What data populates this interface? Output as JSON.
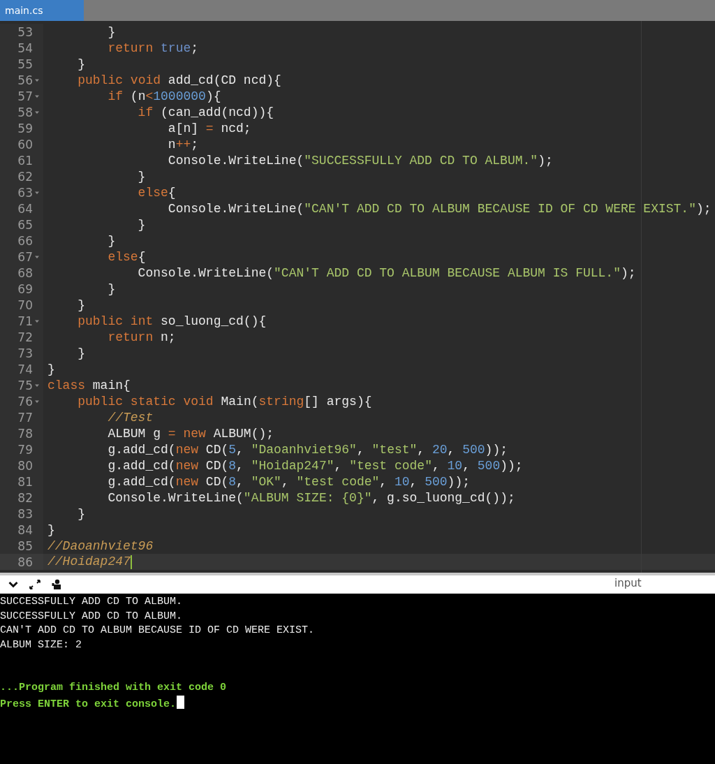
{
  "tabs": [
    {
      "label": "main.cs",
      "selected": true
    }
  ],
  "editor": {
    "lines": [
      {
        "number": "53",
        "foldable": false,
        "current": false,
        "tokens": [
          {
            "kind": "plain",
            "text": "        }"
          }
        ]
      },
      {
        "number": "54",
        "foldable": false,
        "current": false,
        "tokens": [
          {
            "kind": "keyword",
            "text": "        return"
          },
          {
            "kind": "literal",
            "text": " true"
          },
          {
            "kind": "plain",
            "text": ";"
          }
        ]
      },
      {
        "number": "55",
        "foldable": false,
        "current": false,
        "tokens": [
          {
            "kind": "plain",
            "text": "    }"
          }
        ]
      },
      {
        "number": "56",
        "foldable": true,
        "current": false,
        "tokens": [
          {
            "kind": "keyword",
            "text": "    public"
          },
          {
            "kind": "keyword",
            "text": " void"
          },
          {
            "kind": "plain",
            "text": " add_cd(CD ncd){"
          }
        ]
      },
      {
        "number": "57",
        "foldable": true,
        "current": false,
        "tokens": [
          {
            "kind": "keyword",
            "text": "        if"
          },
          {
            "kind": "plain",
            "text": " (n"
          },
          {
            "kind": "operator",
            "text": "<"
          },
          {
            "kind": "number",
            "text": "1000000"
          },
          {
            "kind": "plain",
            "text": "){"
          }
        ]
      },
      {
        "number": "58",
        "foldable": true,
        "current": false,
        "tokens": [
          {
            "kind": "keyword",
            "text": "            if"
          },
          {
            "kind": "plain",
            "text": " (can_add(ncd)){"
          }
        ]
      },
      {
        "number": "59",
        "foldable": false,
        "current": false,
        "tokens": [
          {
            "kind": "plain",
            "text": "                a[n] "
          },
          {
            "kind": "operator",
            "text": "="
          },
          {
            "kind": "plain",
            "text": " ncd;"
          }
        ]
      },
      {
        "number": "60",
        "foldable": false,
        "current": false,
        "tokens": [
          {
            "kind": "plain",
            "text": "                n"
          },
          {
            "kind": "operator",
            "text": "++"
          },
          {
            "kind": "plain",
            "text": ";"
          }
        ]
      },
      {
        "number": "61",
        "foldable": false,
        "current": false,
        "tokens": [
          {
            "kind": "plain",
            "text": "                Console.WriteLine("
          },
          {
            "kind": "string",
            "text": "\"SUCCESSFULLY ADD CD TO ALBUM.\""
          },
          {
            "kind": "plain",
            "text": ");"
          }
        ]
      },
      {
        "number": "62",
        "foldable": false,
        "current": false,
        "tokens": [
          {
            "kind": "plain",
            "text": "            }"
          }
        ]
      },
      {
        "number": "63",
        "foldable": true,
        "current": false,
        "tokens": [
          {
            "kind": "keyword",
            "text": "            else"
          },
          {
            "kind": "plain",
            "text": "{"
          }
        ]
      },
      {
        "number": "64",
        "foldable": false,
        "current": false,
        "tokens": [
          {
            "kind": "plain",
            "text": "                Console.WriteLine("
          },
          {
            "kind": "string",
            "text": "\"CAN'T ADD CD TO ALBUM BECAUSE ID OF CD WERE EXIST.\""
          },
          {
            "kind": "plain",
            "text": ");"
          }
        ]
      },
      {
        "number": "65",
        "foldable": false,
        "current": false,
        "tokens": [
          {
            "kind": "plain",
            "text": "            }"
          }
        ]
      },
      {
        "number": "66",
        "foldable": false,
        "current": false,
        "tokens": [
          {
            "kind": "plain",
            "text": "        }"
          }
        ]
      },
      {
        "number": "67",
        "foldable": true,
        "current": false,
        "tokens": [
          {
            "kind": "keyword",
            "text": "        else"
          },
          {
            "kind": "plain",
            "text": "{"
          }
        ]
      },
      {
        "number": "68",
        "foldable": false,
        "current": false,
        "tokens": [
          {
            "kind": "plain",
            "text": "            Console.WriteLine("
          },
          {
            "kind": "string",
            "text": "\"CAN'T ADD CD TO ALBUM BECAUSE ALBUM IS FULL.\""
          },
          {
            "kind": "plain",
            "text": ");"
          }
        ]
      },
      {
        "number": "69",
        "foldable": false,
        "current": false,
        "tokens": [
          {
            "kind": "plain",
            "text": "        }"
          }
        ]
      },
      {
        "number": "70",
        "foldable": false,
        "current": false,
        "tokens": [
          {
            "kind": "plain",
            "text": "    }"
          }
        ]
      },
      {
        "number": "71",
        "foldable": true,
        "current": false,
        "tokens": [
          {
            "kind": "keyword",
            "text": "    public"
          },
          {
            "kind": "keyword",
            "text": " int"
          },
          {
            "kind": "plain",
            "text": " so_luong_cd(){"
          }
        ]
      },
      {
        "number": "72",
        "foldable": false,
        "current": false,
        "tokens": [
          {
            "kind": "keyword",
            "text": "        return"
          },
          {
            "kind": "plain",
            "text": " n;"
          }
        ]
      },
      {
        "number": "73",
        "foldable": false,
        "current": false,
        "tokens": [
          {
            "kind": "plain",
            "text": "    }"
          }
        ]
      },
      {
        "number": "74",
        "foldable": false,
        "current": false,
        "tokens": [
          {
            "kind": "plain",
            "text": "}"
          }
        ]
      },
      {
        "number": "75",
        "foldable": true,
        "current": false,
        "tokens": [
          {
            "kind": "keyword",
            "text": "class"
          },
          {
            "kind": "plain",
            "text": " main{"
          }
        ]
      },
      {
        "number": "76",
        "foldable": true,
        "current": false,
        "tokens": [
          {
            "kind": "keyword",
            "text": "    public"
          },
          {
            "kind": "keyword",
            "text": " static"
          },
          {
            "kind": "keyword",
            "text": " void"
          },
          {
            "kind": "plain",
            "text": " Main("
          },
          {
            "kind": "keyword",
            "text": "string"
          },
          {
            "kind": "plain",
            "text": "[] args){"
          }
        ]
      },
      {
        "number": "77",
        "foldable": false,
        "current": false,
        "tokens": [
          {
            "kind": "comment",
            "text": "        //Test"
          }
        ]
      },
      {
        "number": "78",
        "foldable": false,
        "current": false,
        "tokens": [
          {
            "kind": "plain",
            "text": "        ALBUM g "
          },
          {
            "kind": "operator",
            "text": "="
          },
          {
            "kind": "keyword",
            "text": " new"
          },
          {
            "kind": "plain",
            "text": " ALBUM();"
          }
        ]
      },
      {
        "number": "79",
        "foldable": false,
        "current": false,
        "tokens": [
          {
            "kind": "plain",
            "text": "        g.add_cd("
          },
          {
            "kind": "keyword",
            "text": "new"
          },
          {
            "kind": "plain",
            "text": " CD("
          },
          {
            "kind": "number",
            "text": "5"
          },
          {
            "kind": "plain",
            "text": ", "
          },
          {
            "kind": "string",
            "text": "\"Daoanhviet96\""
          },
          {
            "kind": "plain",
            "text": ", "
          },
          {
            "kind": "string",
            "text": "\"test\""
          },
          {
            "kind": "plain",
            "text": ", "
          },
          {
            "kind": "number",
            "text": "20"
          },
          {
            "kind": "plain",
            "text": ", "
          },
          {
            "kind": "number",
            "text": "500"
          },
          {
            "kind": "plain",
            "text": "));"
          }
        ]
      },
      {
        "number": "80",
        "foldable": false,
        "current": false,
        "tokens": [
          {
            "kind": "plain",
            "text": "        g.add_cd("
          },
          {
            "kind": "keyword",
            "text": "new"
          },
          {
            "kind": "plain",
            "text": " CD("
          },
          {
            "kind": "number",
            "text": "8"
          },
          {
            "kind": "plain",
            "text": ", "
          },
          {
            "kind": "string",
            "text": "\"Hoidap247\""
          },
          {
            "kind": "plain",
            "text": ", "
          },
          {
            "kind": "string",
            "text": "\"test code\""
          },
          {
            "kind": "plain",
            "text": ", "
          },
          {
            "kind": "number",
            "text": "10"
          },
          {
            "kind": "plain",
            "text": ", "
          },
          {
            "kind": "number",
            "text": "500"
          },
          {
            "kind": "plain",
            "text": "));"
          }
        ]
      },
      {
        "number": "81",
        "foldable": false,
        "current": false,
        "tokens": [
          {
            "kind": "plain",
            "text": "        g.add_cd("
          },
          {
            "kind": "keyword",
            "text": "new"
          },
          {
            "kind": "plain",
            "text": " CD("
          },
          {
            "kind": "number",
            "text": "8"
          },
          {
            "kind": "plain",
            "text": ", "
          },
          {
            "kind": "string",
            "text": "\"OK\""
          },
          {
            "kind": "plain",
            "text": ", "
          },
          {
            "kind": "string",
            "text": "\"test code\""
          },
          {
            "kind": "plain",
            "text": ", "
          },
          {
            "kind": "number",
            "text": "10"
          },
          {
            "kind": "plain",
            "text": ", "
          },
          {
            "kind": "number",
            "text": "500"
          },
          {
            "kind": "plain",
            "text": "));"
          }
        ]
      },
      {
        "number": "82",
        "foldable": false,
        "current": false,
        "tokens": [
          {
            "kind": "plain",
            "text": "        Console.WriteLine("
          },
          {
            "kind": "string",
            "text": "\"ALBUM SIZE: {0}\""
          },
          {
            "kind": "plain",
            "text": ", g.so_luong_cd());"
          }
        ]
      },
      {
        "number": "83",
        "foldable": false,
        "current": false,
        "tokens": [
          {
            "kind": "plain",
            "text": "    }"
          }
        ]
      },
      {
        "number": "84",
        "foldable": false,
        "current": false,
        "tokens": [
          {
            "kind": "plain",
            "text": "}"
          }
        ]
      },
      {
        "number": "85",
        "foldable": false,
        "current": false,
        "tokens": [
          {
            "kind": "comment",
            "text": "//Daoanhviet96"
          }
        ]
      },
      {
        "number": "86",
        "foldable": false,
        "current": true,
        "tokens": [
          {
            "kind": "comment",
            "text": "//Hoidap247"
          }
        ]
      }
    ]
  },
  "console": {
    "input_label": "input",
    "lines": [
      {
        "kind": "output",
        "text": "SUCCESSFULLY ADD CD TO ALBUM."
      },
      {
        "kind": "output",
        "text": "SUCCESSFULLY ADD CD TO ALBUM."
      },
      {
        "kind": "output",
        "text": "CAN'T ADD CD TO ALBUM BECAUSE ID OF CD WERE EXIST."
      },
      {
        "kind": "output",
        "text": "ALBUM SIZE: 2"
      },
      {
        "kind": "status",
        "text": "...Program finished with exit code 0"
      },
      {
        "kind": "status",
        "text": "Press ENTER to exit console."
      }
    ]
  }
}
